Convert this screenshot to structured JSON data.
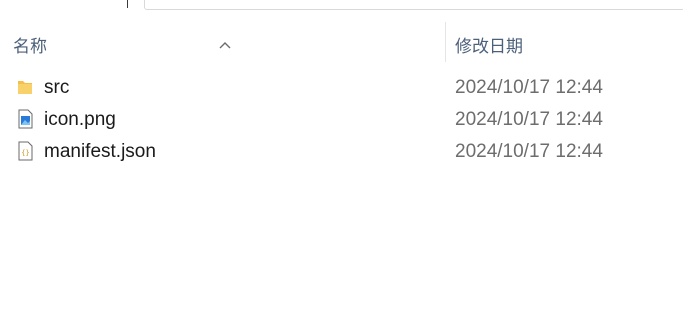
{
  "header": {
    "columns": [
      {
        "label": "名称"
      },
      {
        "label": "修改日期"
      }
    ],
    "sort": "ascending-name"
  },
  "files": [
    {
      "name": "src",
      "modified": "2024/10/17 12:44",
      "icon": "folder-icon"
    },
    {
      "name": "icon.png",
      "modified": "2024/10/17 12:44",
      "icon": "png-file-icon"
    },
    {
      "name": "manifest.json",
      "modified": "2024/10/17 12:44",
      "icon": "json-file-icon"
    }
  ],
  "colors": {
    "header_text": "#4c607a",
    "folder": "#f5c04a",
    "date_text": "#6d6d6d"
  }
}
